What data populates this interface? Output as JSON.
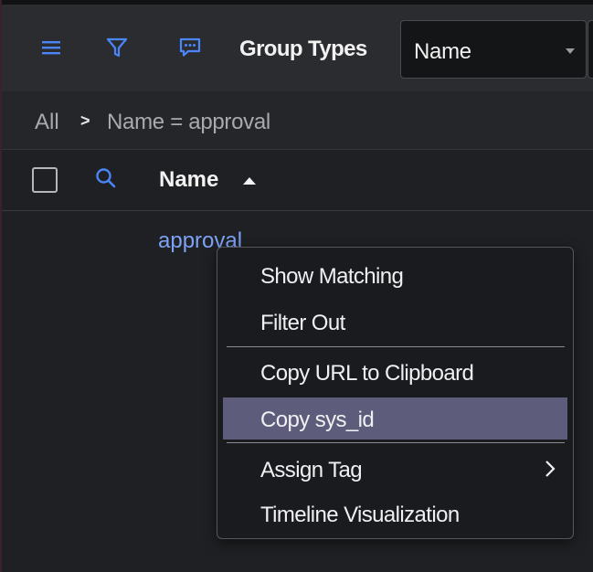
{
  "toolbar": {
    "title": "Group Types",
    "select_value": "Name",
    "icons": [
      "menu-icon",
      "filter-icon",
      "comment-icon"
    ]
  },
  "breadcrumb": {
    "all": "All",
    "separator": ">",
    "condition": "Name = approval"
  },
  "table": {
    "column_header": "Name",
    "sort": "ascending",
    "rows": [
      "approval"
    ]
  },
  "context_menu": {
    "items": [
      {
        "label": "Show Matching"
      },
      {
        "label": "Filter Out"
      },
      {
        "label": "Copy URL to Clipboard"
      },
      {
        "label": "Copy sys_id"
      },
      {
        "label": "Assign Tag"
      },
      {
        "label": "Timeline Visualization"
      }
    ],
    "highlighted": "Copy sys_id"
  },
  "colors": {
    "accent": "#4a86f7",
    "link": "#7da2f5",
    "highlight": "#5d5d7b",
    "background": "#1f2023"
  }
}
